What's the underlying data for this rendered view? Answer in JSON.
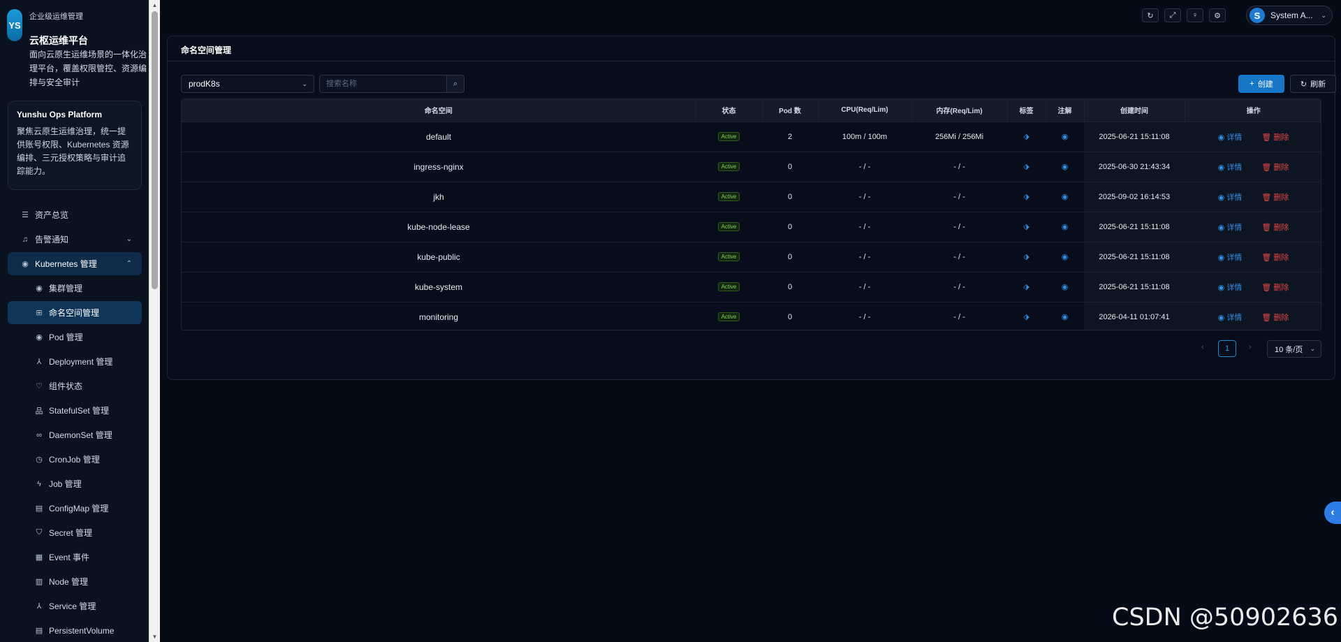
{
  "brand": {
    "logo_text": "YS",
    "subtitle": "企业级运维管理",
    "title": "云枢运维平台",
    "description": "面向云原生运维场景的一体化治理平台，覆盖权限管控、资源编排与安全审计"
  },
  "info_card": {
    "title": "Yunshu Ops Platform",
    "text": "聚焦云原生运维治理，统一提供账号权限、Kubernetes 资源编排、三元授权策略与审计追踪能力。"
  },
  "nav": {
    "assets": "资产总览",
    "alerts": "告警通知",
    "k8s": "Kubernetes 管理",
    "items": [
      {
        "label": "集群管理",
        "icon": "circle-dot-icon"
      },
      {
        "label": "命名空间管理",
        "icon": "grid-icon"
      },
      {
        "label": "Pod 管理",
        "icon": "circle-dot-icon"
      },
      {
        "label": "Deployment 管理",
        "icon": "deploy-icon"
      },
      {
        "label": "组件状态",
        "icon": "heart-icon"
      },
      {
        "label": "StatefulSet 管理",
        "icon": "stateful-icon"
      },
      {
        "label": "DaemonSet 管理",
        "icon": "link-icon"
      },
      {
        "label": "CronJob 管理",
        "icon": "clock-icon"
      },
      {
        "label": "Job 管理",
        "icon": "bolt-icon"
      },
      {
        "label": "ConfigMap 管理",
        "icon": "file-icon"
      },
      {
        "label": "Secret 管理",
        "icon": "shield-icon"
      },
      {
        "label": "Event 事件",
        "icon": "event-icon"
      },
      {
        "label": "Node 管理",
        "icon": "node-icon"
      },
      {
        "label": "Service 管理",
        "icon": "service-icon"
      },
      {
        "label": "PersistentVolume",
        "icon": "volume-icon"
      }
    ]
  },
  "topbar": {
    "user_initial": "S",
    "user_name": "System A..."
  },
  "page": {
    "title": "命名空间管理",
    "cluster": "prodK8s",
    "search_placeholder": "搜索名称",
    "create": "创建",
    "refresh": "刷新"
  },
  "table": {
    "columns": [
      "命名空间",
      "状态",
      "Pod 数",
      "CPU(Req/Lim)",
      "内存(Req/Lim)",
      "标签",
      "注解",
      "创建时间",
      "操作"
    ],
    "detail_label": "详情",
    "delete_label": "删除",
    "rows": [
      {
        "name": "default",
        "status": "Active",
        "pods": "2",
        "cpu": "100m / 100m",
        "mem": "256Mi / 256Mi",
        "created": "2025-06-21 15:11:08"
      },
      {
        "name": "ingress-nginx",
        "status": "Active",
        "pods": "0",
        "cpu": "- / -",
        "mem": "- / -",
        "created": "2025-06-30 21:43:34"
      },
      {
        "name": "jkh",
        "status": "Active",
        "pods": "0",
        "cpu": "- / -",
        "mem": "- / -",
        "created": "2025-09-02 16:14:53"
      },
      {
        "name": "kube-node-lease",
        "status": "Active",
        "pods": "0",
        "cpu": "- / -",
        "mem": "- / -",
        "created": "2025-06-21 15:11:08"
      },
      {
        "name": "kube-public",
        "status": "Active",
        "pods": "0",
        "cpu": "- / -",
        "mem": "- / -",
        "created": "2025-06-21 15:11:08"
      },
      {
        "name": "kube-system",
        "status": "Active",
        "pods": "0",
        "cpu": "- / -",
        "mem": "- / -",
        "created": "2025-06-21 15:11:08"
      },
      {
        "name": "monitoring",
        "status": "Active",
        "pods": "0",
        "cpu": "- / -",
        "mem": "- / -",
        "created": "2026-04-11 01:07:41"
      }
    ]
  },
  "pager": {
    "current": "1",
    "page_size": "10 条/页"
  },
  "watermark": "CSDN @50902636",
  "colors": {
    "accent": "#1677c9",
    "danger": "#e04545",
    "status_active": "#7fd35a",
    "background": "#060b18"
  }
}
